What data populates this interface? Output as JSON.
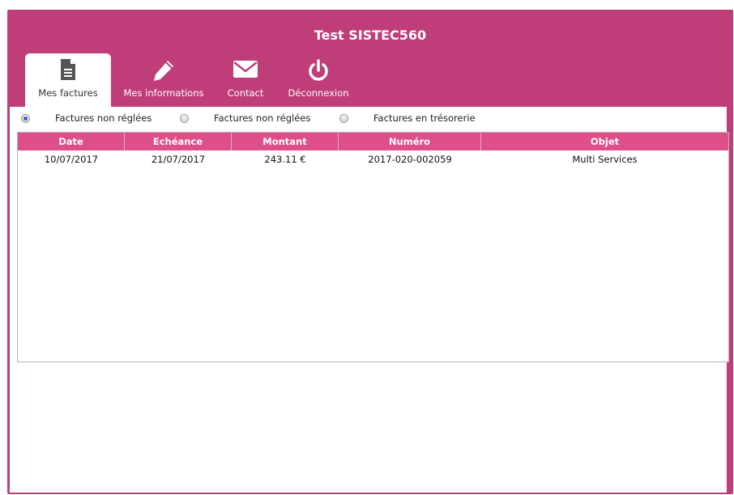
{
  "app": {
    "title": "Test SISTEC560"
  },
  "nav": {
    "tabs": [
      {
        "label": "Mes factures",
        "icon": "document-icon",
        "active": true
      },
      {
        "label": "Mes informations",
        "icon": "pencil-icon",
        "active": false
      },
      {
        "label": "Contact",
        "icon": "envelope-icon",
        "active": false
      },
      {
        "label": "Déconnexion",
        "icon": "power-icon",
        "active": false
      }
    ]
  },
  "filters": {
    "options": [
      {
        "label": "Factures non réglées",
        "checked": true
      },
      {
        "label": "Factures non réglées",
        "checked": false
      },
      {
        "label": "Factures en trésorerie",
        "checked": false
      }
    ]
  },
  "table": {
    "columns": [
      "Date",
      "Echéance",
      "Montant",
      "Numéro",
      "Objet"
    ],
    "rows": [
      [
        "10/07/2017",
        "21/07/2017",
        "243.11 €",
        "2017-020-002059",
        "Multi Services"
      ]
    ]
  },
  "colors": {
    "brand": "#bf3d78",
    "table_header": "#de4e88"
  }
}
